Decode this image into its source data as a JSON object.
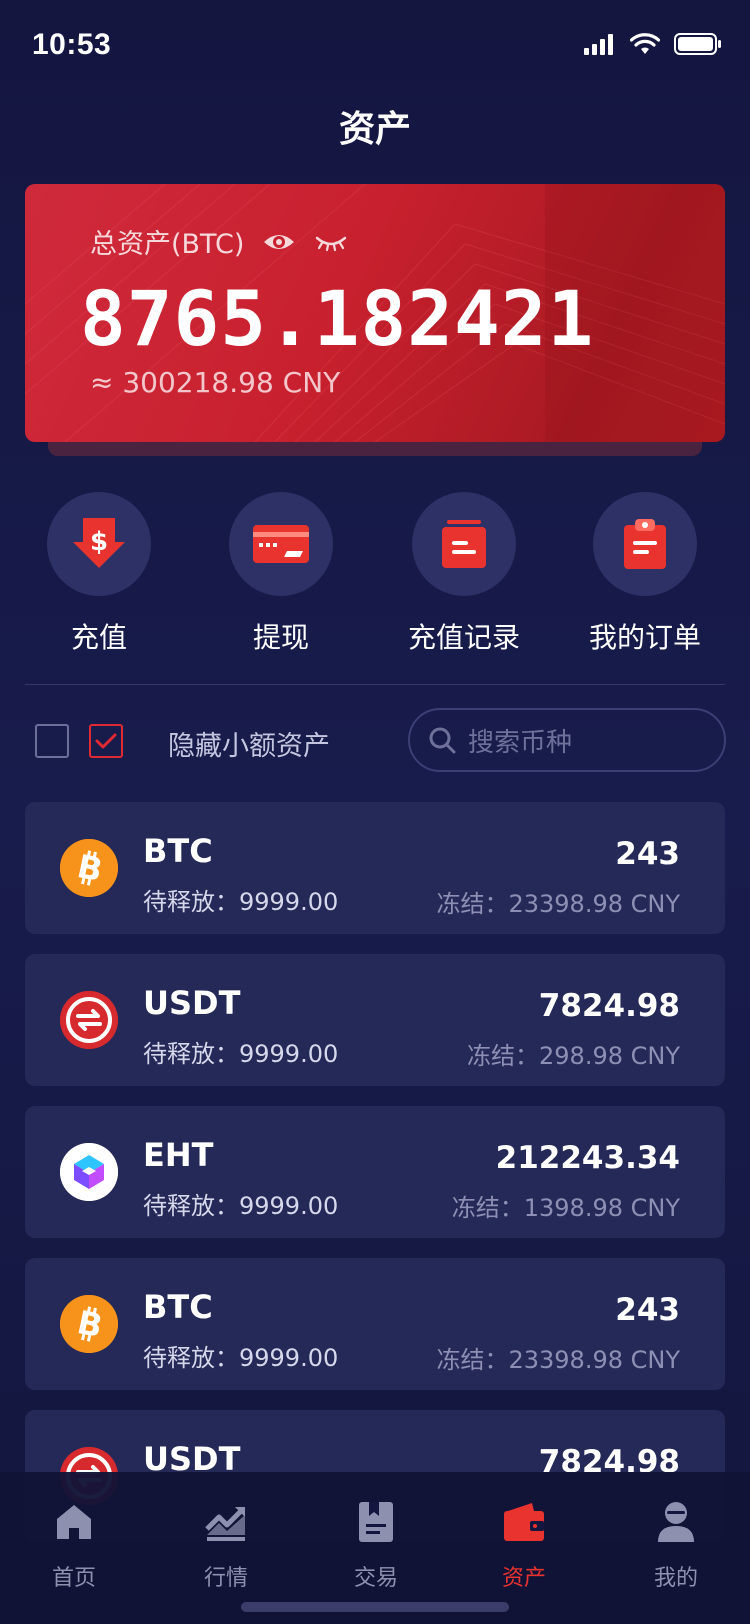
{
  "status_bar": {
    "time": "10:53"
  },
  "page": {
    "title": "资产"
  },
  "asset_card": {
    "label": "总资产(BTC)",
    "total": "8765.182421",
    "equivalent": "≈ 300218.98 CNY"
  },
  "actions": [
    {
      "label": "充值",
      "icon": "deposit-dollar-icon"
    },
    {
      "label": "提现",
      "icon": "card-icon"
    },
    {
      "label": "充值记录",
      "icon": "record-icon"
    },
    {
      "label": "我的订单",
      "icon": "clipboard-icon"
    }
  ],
  "filter": {
    "hide_small_label": "隐藏小额资产",
    "search_placeholder": "搜索币种"
  },
  "coins": [
    {
      "symbol": "BTC",
      "pending": "待释放：9999.00",
      "amount": "243",
      "frozen": "冻结：23398.98 CNY",
      "icon": "bitcoin-icon"
    },
    {
      "symbol": "USDT",
      "pending": "待释放：9999.00",
      "amount": "7824.98",
      "frozen": "冻结：298.98 CNY",
      "icon": "usdt-icon"
    },
    {
      "symbol": "EHT",
      "pending": "待释放：9999.00",
      "amount": "212243.34",
      "frozen": "冻结：1398.98 CNY",
      "icon": "eht-icon"
    },
    {
      "symbol": "BTC",
      "pending": "待释放：9999.00",
      "amount": "243",
      "frozen": "冻结：23398.98 CNY",
      "icon": "bitcoin-icon"
    },
    {
      "symbol": "USDT",
      "pending": "",
      "amount": "7824.98",
      "frozen": "",
      "icon": "usdt-icon"
    }
  ],
  "tabs": [
    {
      "label": "首页",
      "icon": "home-icon",
      "active": false
    },
    {
      "label": "行情",
      "icon": "chart-icon",
      "active": false
    },
    {
      "label": "交易",
      "icon": "trade-icon",
      "active": false
    },
    {
      "label": "资产",
      "icon": "wallet-icon",
      "active": true
    },
    {
      "label": "我的",
      "icon": "profile-icon",
      "active": false
    }
  ],
  "colors": {
    "background": "#161a46",
    "accent_red": "#e02a33",
    "card_row": "#252957"
  }
}
